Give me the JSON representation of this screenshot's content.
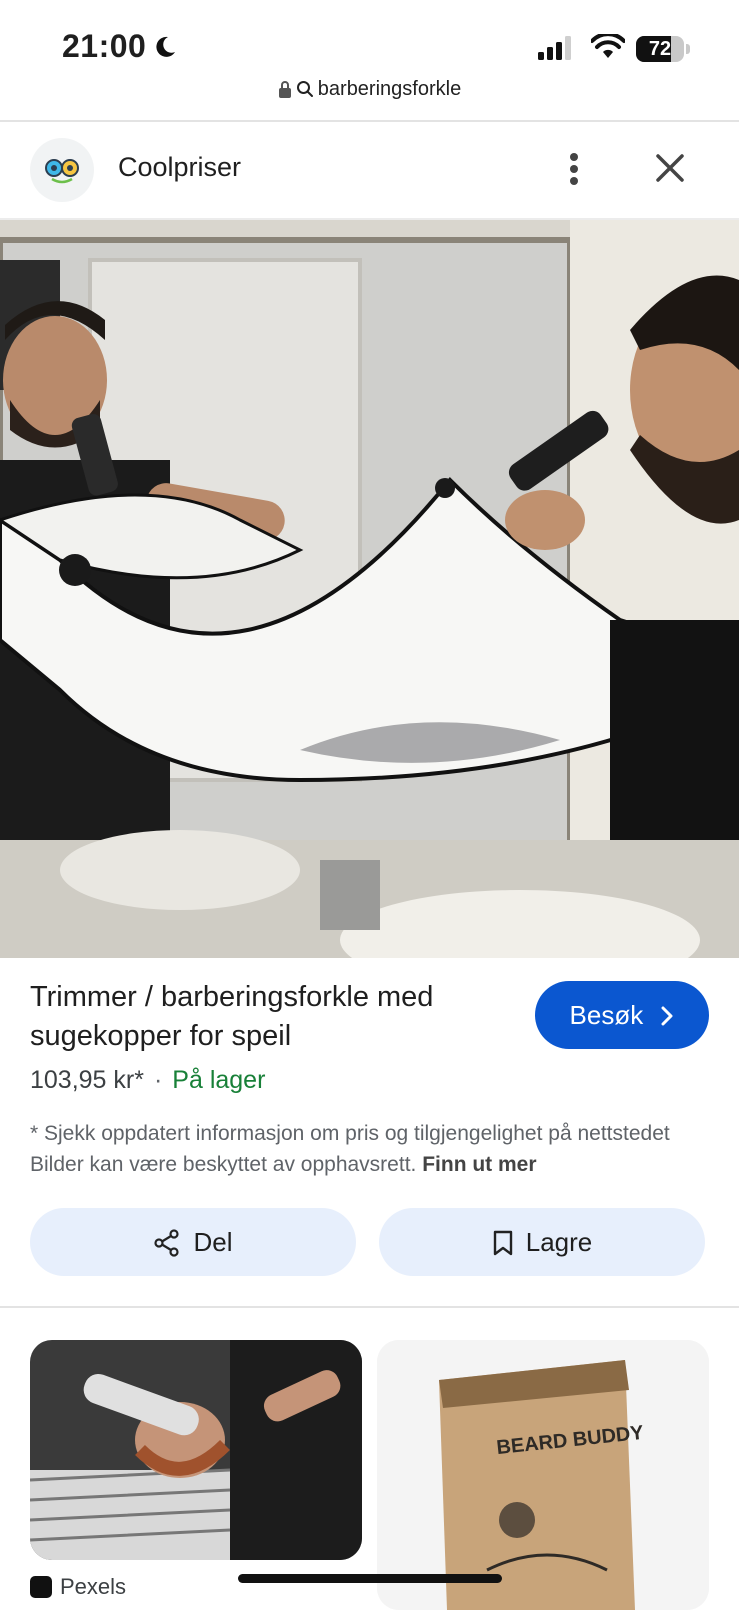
{
  "status_bar": {
    "time": "21:00",
    "battery_level": "72",
    "battery_fraction": 0.72,
    "url": "barberingsforkle"
  },
  "header": {
    "site_name": "Coolpriser",
    "icons": [
      "more-vert-icon",
      "close-icon"
    ]
  },
  "product": {
    "title": "Trimmer / barberingsforkle med sugekopper for speil",
    "visit_label": "Besøk",
    "price": "103,95 kr*",
    "separator": "·",
    "stock": "På lager",
    "disclaimer": "* Sjekk oppdatert informasjon om pris og tilgjengelighet på nettstedet Bilder kan være beskyttet av opphavsrett.",
    "learn_more": "Finn ut mer"
  },
  "actions": {
    "share_label": "Del",
    "save_label": "Lagre"
  },
  "related": {
    "source_1": "Pexels",
    "box_text": "BEARD BUDDY"
  },
  "colors": {
    "accent": "#0b57d0",
    "stock_green": "#188038",
    "pill_bg": "#e7effc"
  }
}
